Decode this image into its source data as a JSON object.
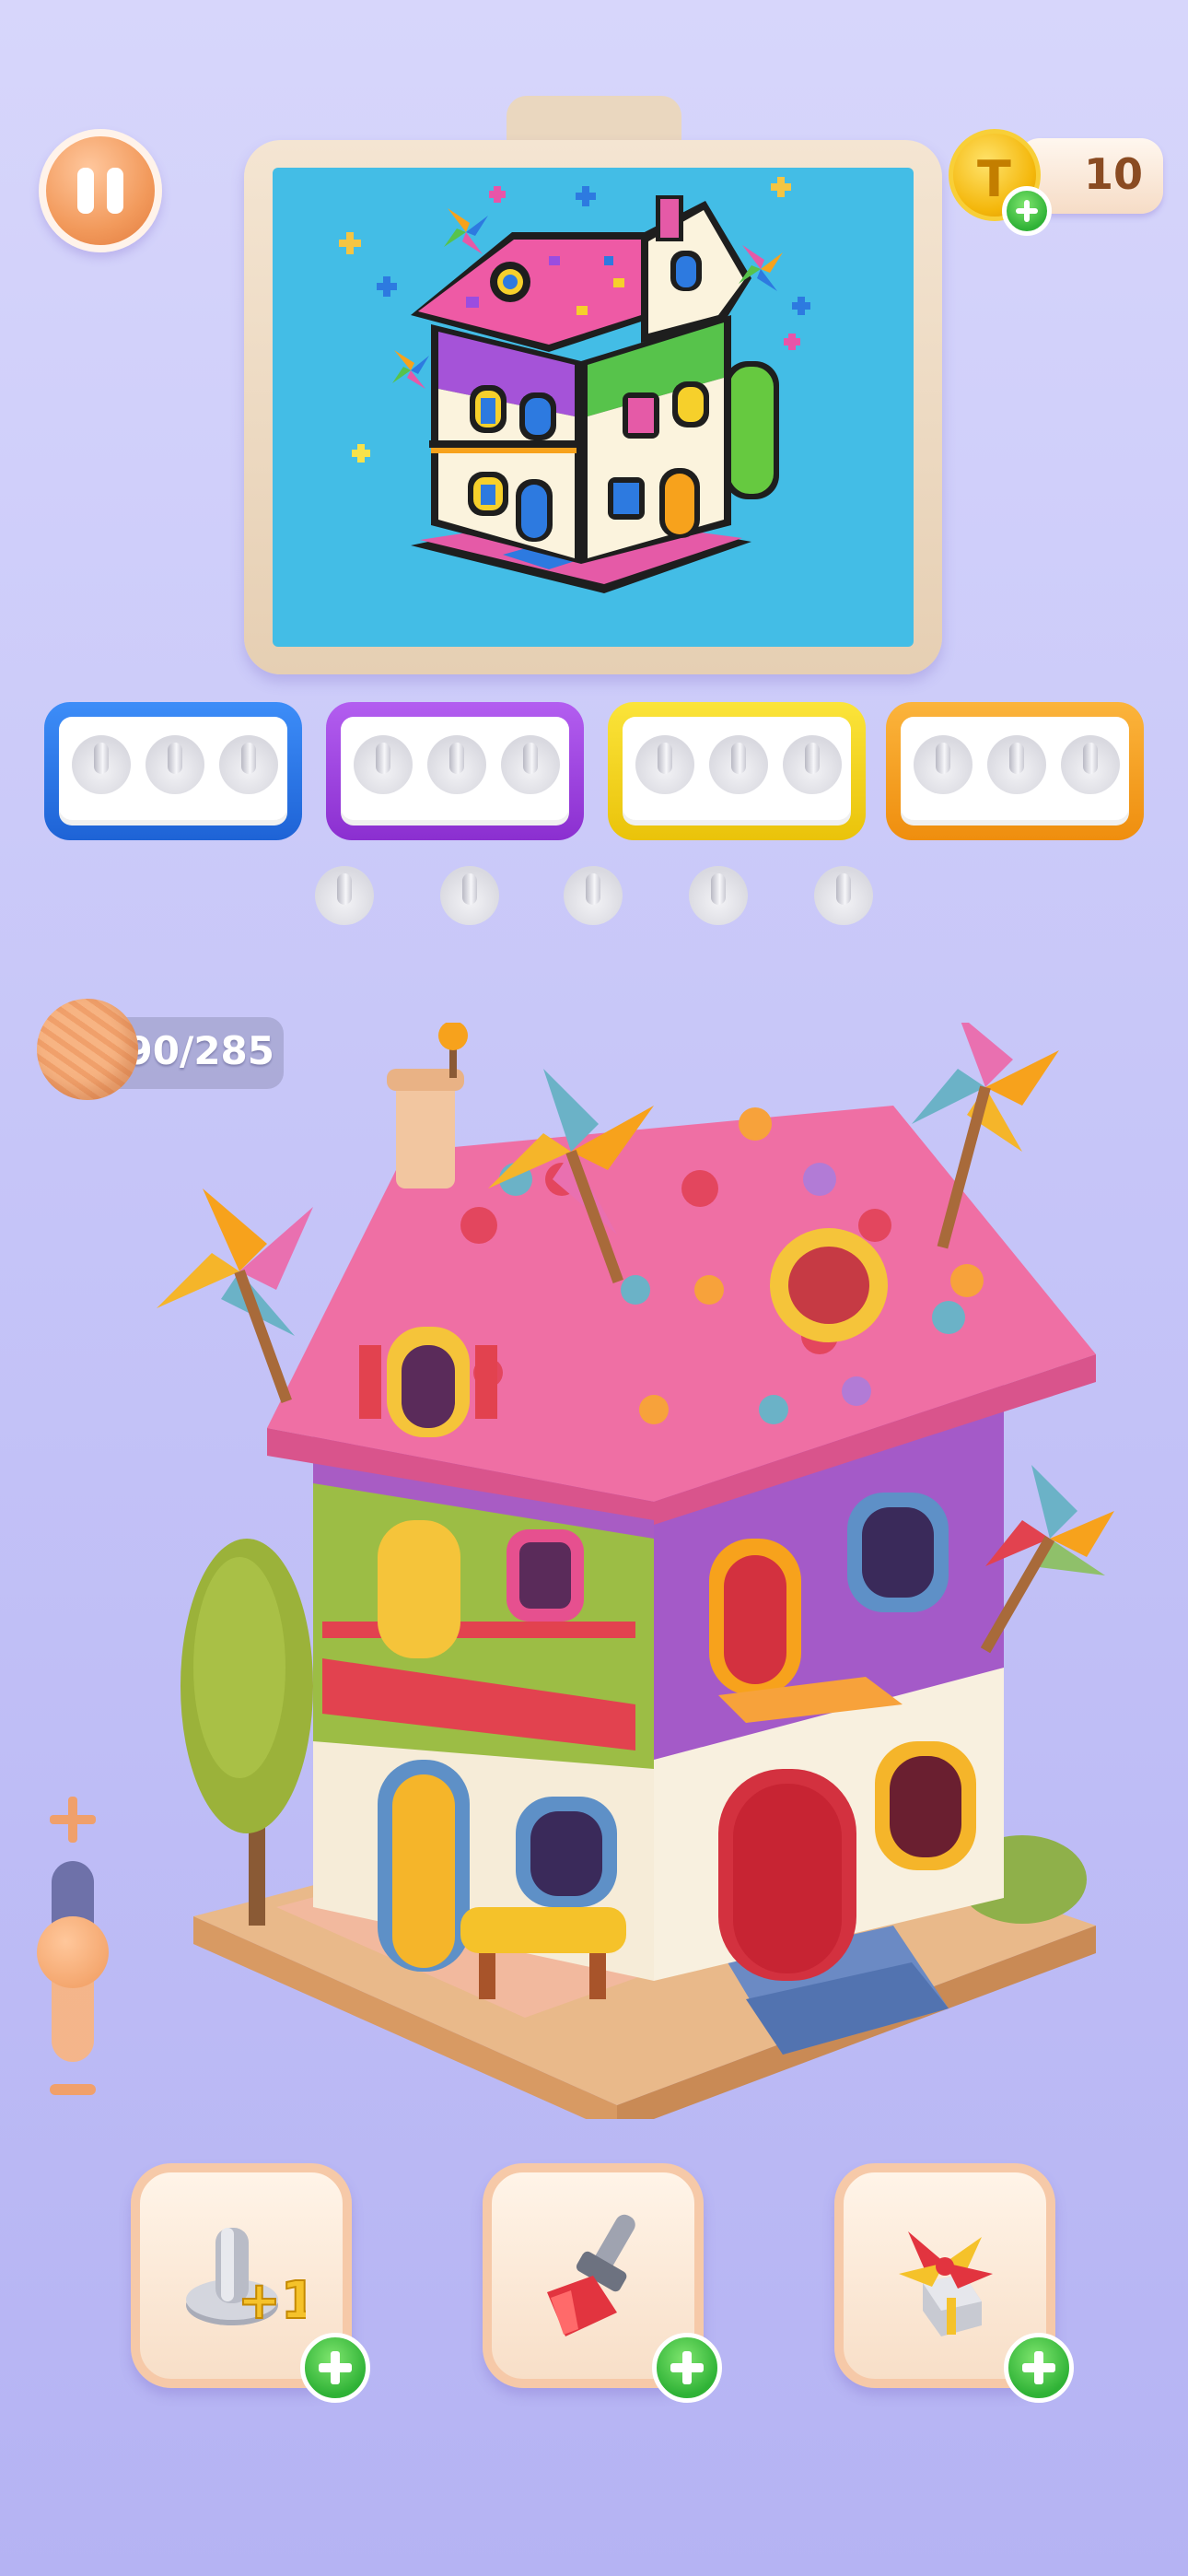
{
  "hud": {
    "coins": "10",
    "yarn_counter": "90/285",
    "icons": [
      "pause-icon",
      "coin-icon",
      "add-coins-icon",
      "yarn-ball-icon",
      "zoom-in-icon",
      "zoom-out-icon"
    ]
  },
  "slots": [
    {
      "color": "#2f7cf2",
      "pegs": 3
    },
    {
      "color": "#a443e8",
      "pegs": 3
    },
    {
      "color": "#f5d81a",
      "pegs": 3
    },
    {
      "color": "#f7a21c",
      "pegs": 3
    }
  ],
  "loose_pegs": 5,
  "zoom_level": 0.5,
  "boosters": [
    {
      "name": "extra-peg",
      "label": "+1",
      "icon": "peg-plus-one-icon"
    },
    {
      "name": "brush",
      "icon": "brush-icon"
    },
    {
      "name": "pinwheel",
      "icon": "pinwheel-box-icon"
    }
  ],
  "colors": {
    "background": "#c6c5f8",
    "accent_orange": "#f09a5d",
    "plus_green": "#2fb236",
    "board_sky": "#43bde6"
  }
}
